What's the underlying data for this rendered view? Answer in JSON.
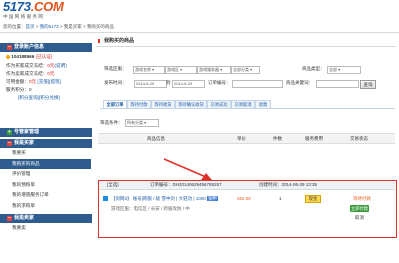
{
  "logo": {
    "brand_main": "5173",
    "brand_suffix": ".COM",
    "tagline": "中国网络服务网"
  },
  "breadcrumb": {
    "prefix": "您的位置：",
    "home": "首页",
    "sep1": " > ",
    "my": "我的5173",
    "sep2": " > 我是买家 > 我购买的商品"
  },
  "account": {
    "header": "登录账户信息",
    "user_id": "104188566",
    "status": "(已认证)",
    "frozen_label": "作为买家成交冻结：",
    "frozen_value": "0元",
    "frozen_note": "(说明)",
    "seller_frozen_label": "作为卖家成交冻结：",
    "seller_frozen_value": "0元",
    "balance_label": "可用金额：",
    "balance_value": "0元",
    "recharge": "[充值]",
    "withdraw": "[提现]",
    "points_label": "服务积分：",
    "points_value": "0",
    "query": "[积分查询]",
    "redeem": "[积分兑换]"
  },
  "sidebar": {
    "manage_header": "号管家管理",
    "buyer_header": "我是买家",
    "buyer_items": [
      "我要买",
      "我购买的商品",
      "评价管理",
      "我的预购单",
      "我的增值服务订单",
      "我的求购单"
    ],
    "seller_header": "我是卖家",
    "seller_items": [
      "我要卖"
    ]
  },
  "main": {
    "title": "我购买的商品",
    "filter": {
      "type_label": "筛选区服：",
      "select_game": "游戏名称",
      "select_server": "游戏区",
      "select_area": "游戏服务器",
      "select_all": "全部分类",
      "goods_type_label": "商品类型：",
      "goods_type_value": "全部",
      "time_label": "发布时间：",
      "start_date": "2014-6-29",
      "to": "到",
      "end_date": "2014-6-29",
      "order_label": "订单编号：",
      "keyword_label": "商品关键词：",
      "search_btn": "查询"
    },
    "tabs": [
      "全部订单",
      "等待付款",
      "等待收货",
      "等待确认收货",
      "交易成功",
      "交易取消",
      "退款"
    ],
    "filter_row": {
      "label": "筛选条件：",
      "value": "所有分类"
    },
    "columns": {
      "info": "商品信息",
      "price": "单价",
      "qty": "件数",
      "fee": "服务费用",
      "status": "交易状态"
    },
    "order": {
      "check": "[全选]",
      "order_label": "订单编号：",
      "order_id": "DH20140629456785257",
      "created_label": "创建时间：",
      "created_time": "2014-06-29 13:35",
      "product_prefix": "【",
      "product_game": "剑网3",
      "product_name": "】 账号|跨服 / 级  雪中剑 | 大轻功 | 1000",
      "product_tag": "钢甲",
      "product_line2": "游戏区服：电信区 / 长安 / 跨服攻防 / 中",
      "price": "262.00",
      "qty": "1",
      "pay_badge": "现金",
      "status": "等待付款",
      "pay_btn": "立即付款",
      "cancel": "取消"
    }
  },
  "colors": {
    "header_blue": "#2f5c8f",
    "link_blue": "#1a5ba6",
    "accent_red": "#e0302a",
    "pay_green": "#3a9b3a",
    "price_orange": "#e85a1d"
  }
}
